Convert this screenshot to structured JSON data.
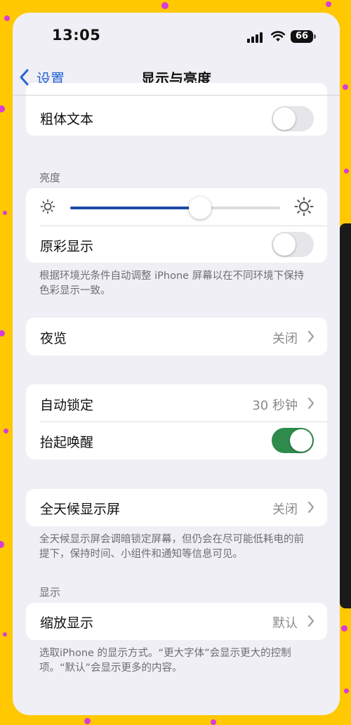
{
  "status_bar": {
    "time": "13:05",
    "battery": "66",
    "signal_icon": "signal-bars-icon",
    "wifi_icon": "wifi-icon"
  },
  "nav": {
    "back_label": "设置",
    "title": "显示与亮度"
  },
  "bold_text": {
    "label": "粗体文本",
    "on": false
  },
  "brightness": {
    "header": "亮度",
    "level": 0.62,
    "true_tone": {
      "label": "原彩显示",
      "on": false
    },
    "footnote": "根据环境光条件自动调整 iPhone 屏幕以在不同环境下保持色彩显示一致。"
  },
  "night_shift": {
    "label": "夜览",
    "value": "关闭"
  },
  "lock": {
    "auto_lock": {
      "label": "自动锁定",
      "value": "30 秒钟"
    },
    "raise_to_wake": {
      "label": "抬起唤醒",
      "on": true
    }
  },
  "always_on": {
    "label": "全天候显示屏",
    "value": "关闭",
    "footnote": "全天候显示屏会调暗锁定屏幕，但仍会在尽可能低耗电的前提下，保持时间、小组件和通知等信息可见。"
  },
  "display": {
    "header": "显示",
    "zoom": {
      "label": "缩放显示",
      "value": "默认"
    },
    "footnote": "选取iPhone 的显示方式。“更大字体”会显示更大的控制项。“默认”会显示更多的内容。"
  },
  "colors": {
    "accent": "#2463d6",
    "toggle_on": "#2e8b4c",
    "slider": "#1e4ba8",
    "background": "#ffc800",
    "confetti": "#d83bd8"
  }
}
